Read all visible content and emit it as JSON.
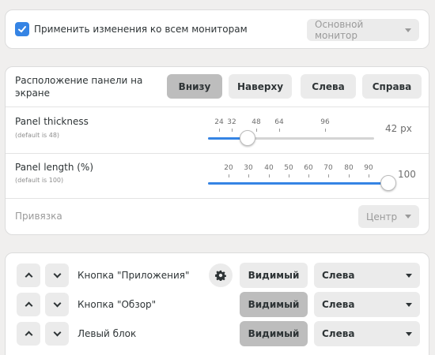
{
  "monitors": {
    "apply_all_label": "Применить изменения ко всем мониторам",
    "apply_all_checked": true,
    "monitor_select": "Основной монитор"
  },
  "position": {
    "label": "Расположение панели на экране",
    "options": [
      "Внизу",
      "Наверху",
      "Слева",
      "Справа"
    ],
    "selected": "Внизу"
  },
  "thickness": {
    "label": "Panel thickness",
    "sublabel": "(default is 48)",
    "marks": [
      "24",
      "32",
      "48",
      "64",
      "96"
    ],
    "value_text": "42 px",
    "value": 42,
    "min": 16,
    "max": 128
  },
  "length": {
    "label": "Panel length (%)",
    "sublabel": "(default is 100)",
    "marks": [
      "20",
      "30",
      "40",
      "50",
      "60",
      "70",
      "80",
      "90"
    ],
    "value_text": "100",
    "value": 100,
    "min": 10,
    "max": 100
  },
  "anchor": {
    "label": "Привязка",
    "select": "Центр"
  },
  "elements": [
    {
      "name": "Кнопка \"Приложения\"",
      "visibility": "Видимый",
      "position": "Слева",
      "has_settings": true
    },
    {
      "name": "Кнопка \"Обзор\"",
      "visibility": "Видимый",
      "position": "Слева",
      "has_settings": false
    },
    {
      "name": "Левый блок",
      "visibility": "Видимый",
      "position": "Слева",
      "has_settings": false
    }
  ],
  "colors": {
    "accent": "#3584e4",
    "active_button": "#bdbdbd"
  }
}
